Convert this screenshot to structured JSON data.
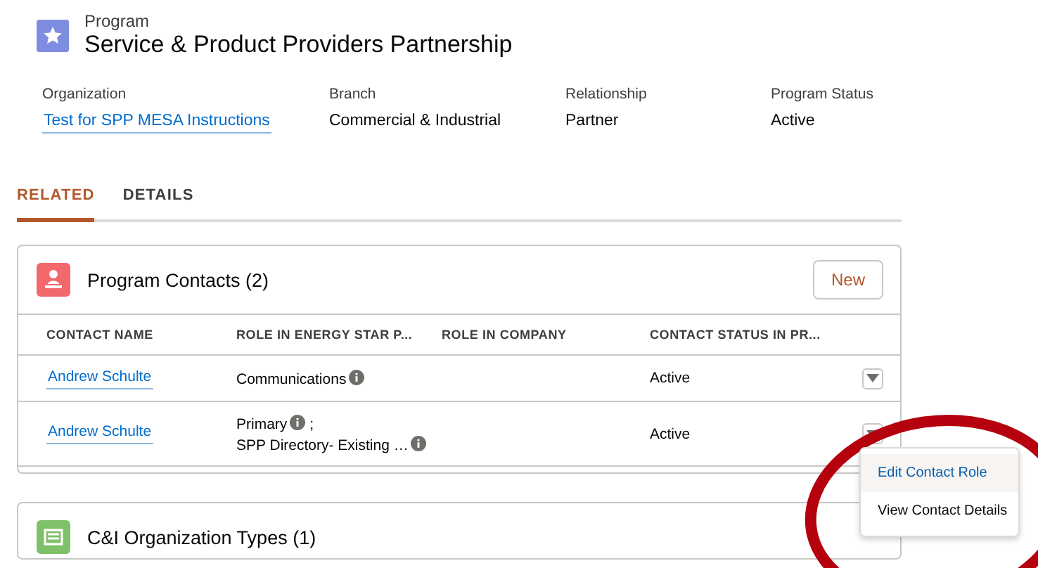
{
  "record": {
    "object_label": "Program",
    "title": "Service & Product Providers Partnership"
  },
  "fields": [
    {
      "label": "Organization",
      "value": "Test for SPP MESA Instructions",
      "kind": "link"
    },
    {
      "label": "Branch",
      "value": "Commercial & Industrial",
      "kind": "text"
    },
    {
      "label": "Relationship",
      "value": "Partner",
      "kind": "text"
    },
    {
      "label": "Program Status",
      "value": "Active",
      "kind": "text"
    }
  ],
  "tabs": [
    {
      "label": "RELATED",
      "selected": true
    },
    {
      "label": "DETAILS",
      "selected": false
    }
  ],
  "related_lists": [
    {
      "title": "Program Contacts (2)",
      "kind": "contacts",
      "new_button": "New",
      "columns": [
        "CONTACT NAME",
        "ROLE IN ENERGY STAR P...",
        "ROLE IN COMPANY",
        "CONTACT STATUS IN PR..."
      ],
      "rows": [
        {
          "contact": "Andrew Schulte",
          "roles": [
            {
              "text": "Communications",
              "info": true
            }
          ],
          "status": "Active"
        },
        {
          "contact": "Andrew Schulte",
          "roles": [
            {
              "text": "Primary",
              "info": true,
              "suffix": ";"
            },
            {
              "text": "SPP Directory- Existing …",
              "info": true
            }
          ],
          "status": "Active",
          "menu": [
            {
              "label": "Edit Contact Role",
              "selected": true
            },
            {
              "label": "View Contact Details",
              "selected": false
            }
          ]
        }
      ]
    },
    {
      "title": "C&I Organization Types (1)",
      "kind": "types"
    }
  ],
  "annotation": {
    "kind": "ellipse"
  }
}
